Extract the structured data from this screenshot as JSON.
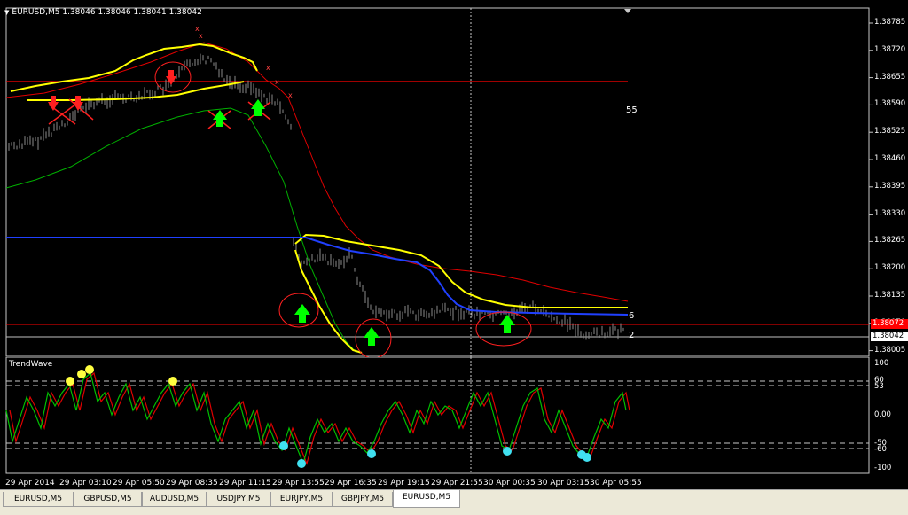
{
  "chart": {
    "symbol_header": "EURUSD,M5  1.38046 1.38046 1.38041 1.38042",
    "price_labels": [
      "1.38785",
      "1.38720",
      "1.38655",
      "1.38590",
      "1.38525",
      "1.38460",
      "1.38395",
      "1.38330",
      "1.38265",
      "1.38200",
      "1.38135",
      "1.38070",
      "1.38005"
    ],
    "current_price_badge": "1.38072",
    "bid_price_badge": "1.38042",
    "annotation_55": "55",
    "annotation_6": "6",
    "annotation_2": "2",
    "colors": {
      "background": "#000000",
      "candles": "#8a8a8a",
      "yellow_band": "#ffff00",
      "red_line": "#ff0000",
      "green_line": "#00c000",
      "blue_line": "#2040ff",
      "marker_up": "#00ff00",
      "marker_down": "#ff0000",
      "cyan_dot": "#40e0f0",
      "yellow_dot": "#ffff40"
    }
  },
  "indicator": {
    "title": "TrendWave",
    "levels": [
      "100",
      "60",
      "53",
      "0.00",
      "-50",
      "-60",
      "-100"
    ]
  },
  "time_axis": [
    "29 Apr 2014",
    "29 Apr 03:10",
    "29 Apr 05:50",
    "29 Apr 08:35",
    "29 Apr 11:15",
    "29 Apr 13:55",
    "29 Apr 16:35",
    "29 Apr 19:15",
    "29 Apr 21:55",
    "30 Apr 00:35",
    "30 Apr 03:15",
    "30 Apr 05:55"
  ],
  "tabs": [
    {
      "label": "EURUSD,M5",
      "active": false
    },
    {
      "label": "GBPUSD,M5",
      "active": false
    },
    {
      "label": "AUDUSD,M5",
      "active": false
    },
    {
      "label": "USDJPY,M5",
      "active": false
    },
    {
      "label": "EURJPY,M5",
      "active": false
    },
    {
      "label": "GBPJPY,M5",
      "active": false
    },
    {
      "label": "EURUSD,M5",
      "active": true
    }
  ]
}
